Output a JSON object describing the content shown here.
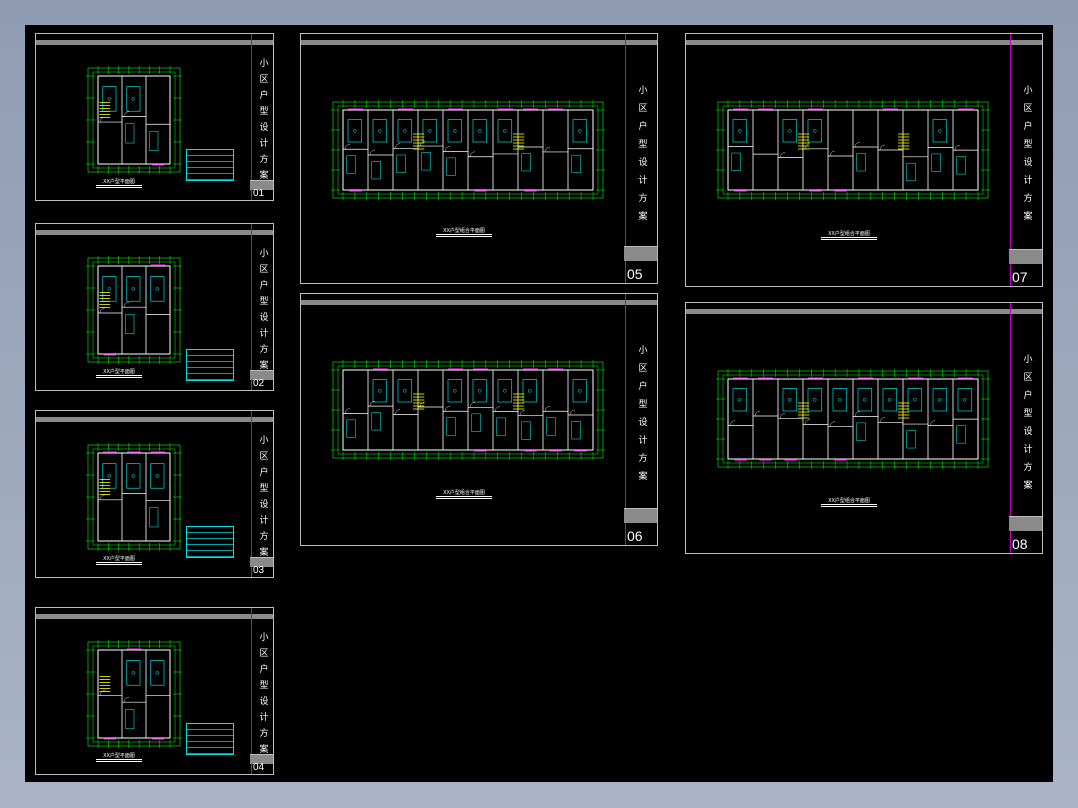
{
  "canvas": {
    "background": "#000000"
  },
  "title_vertical": [
    "小",
    "区",
    "户",
    "型",
    "设",
    "计",
    "方",
    "案"
  ],
  "sheets": [
    {
      "number": "01",
      "caption": "XX户型平面图"
    },
    {
      "number": "02",
      "caption": "XX户型平面图"
    },
    {
      "number": "03",
      "caption": "XX户型平面图"
    },
    {
      "number": "04",
      "caption": "XX户型平面图"
    },
    {
      "number": "05",
      "caption": "XX户型组合平面图"
    },
    {
      "number": "06",
      "caption": "XX户型组合平面图"
    },
    {
      "number": "07",
      "caption": "XX户型组合平面图"
    },
    {
      "number": "08",
      "caption": "XX户型组合平面图"
    }
  ],
  "colors": {
    "dimension": "#00ff00",
    "wall": "#ffffff",
    "fixture": "#00ffff",
    "accent": "#ff00ff",
    "stair": "#ffff00"
  }
}
